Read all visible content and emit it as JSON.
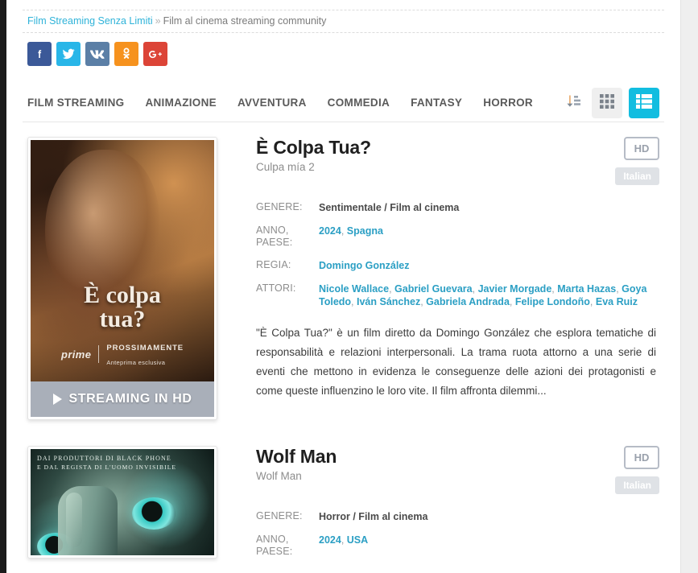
{
  "breadcrumb": {
    "home_label": "Film Streaming Senza Limiti",
    "separator": "»",
    "current_label": "Film al cinema streaming community"
  },
  "social": [
    {
      "name": "facebook",
      "label": "f",
      "color": "#3b5998"
    },
    {
      "name": "twitter",
      "label": "t",
      "color": "#29b6e8"
    },
    {
      "name": "vk",
      "label": "vk",
      "color": "#5b7fa6"
    },
    {
      "name": "odnoklassniki",
      "label": "ok",
      "color": "#f6921e"
    },
    {
      "name": "google-plus",
      "label": "g+",
      "color": "#dc4437"
    }
  ],
  "nav": {
    "items": [
      {
        "label": "FILM STREAMING"
      },
      {
        "label": "ANIMAZIONE"
      },
      {
        "label": "AVVENTURA"
      },
      {
        "label": "COMMEDIA"
      },
      {
        "label": "FANTASY"
      },
      {
        "label": "HORROR"
      }
    ],
    "sort_icon": "sort-icon",
    "grid_icon": "grid-view-icon",
    "list_icon": "list-view-icon",
    "active_view": "list",
    "accent_color": "#12bde0"
  },
  "labels": {
    "genere": "GENERE:",
    "anno_paese": "ANNO, PAESE:",
    "regia": "REGIA:",
    "attori": "ATTORI:"
  },
  "movies": [
    {
      "title": "È Colpa Tua?",
      "original_title": "Culpa mía 2",
      "quality_badge": "HD",
      "language_badge": "Italian",
      "genre": "Sentimentale / Film al cinema",
      "year": "2024",
      "country": "Spagna",
      "director": "Domingo González",
      "actors": [
        "Nicole Wallace",
        "Gabriel Guevara",
        "Javier Morgade",
        "Marta Hazas",
        "Goya Toledo",
        "Iván Sánchez",
        "Gabriela Andrada",
        "Felipe Londoño",
        "Eva Ruiz"
      ],
      "description": "\"È Colpa Tua?\" è un film diretto da Domingo González che esplora tematiche di responsabilità e relazioni interpersonali. La trama ruota attorno a una serie di eventi che mettono in evidenza le conseguenze delle azioni dei protagonisti e come queste influenzino le loro vite. Il film affronta dilemmi...",
      "poster": {
        "title_line1": "È colpa",
        "title_line2": "tua?",
        "brand": "prime",
        "tag_line1": "PROSSIMAMENTE",
        "tag_line2": "Anteprima esclusiva"
      },
      "stream_button": "STREAMING IN HD"
    },
    {
      "title": "Wolf Man",
      "original_title": "Wolf Man",
      "quality_badge": "HD",
      "language_badge": "Italian",
      "genre": "Horror / Film al cinema",
      "year": "2024",
      "country": "USA",
      "poster": {
        "credit_line1": "DAI PRODUTTORI DI BLACK PHONE",
        "credit_line2": "E DAL REGISTA DI L'UOMO INVISIBILE"
      }
    }
  ]
}
